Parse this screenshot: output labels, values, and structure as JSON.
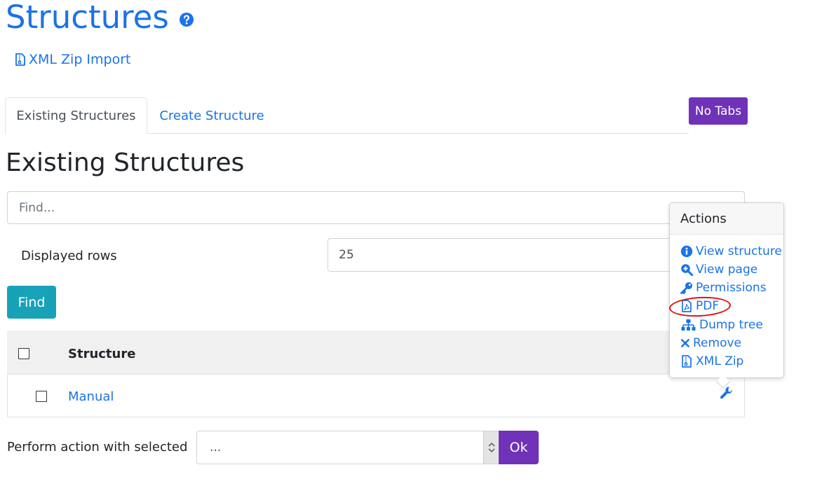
{
  "header": {
    "title": "Structures",
    "help_icon": "question-circle-icon"
  },
  "import": {
    "label": "XML Zip Import",
    "icon": "file-archive-icon"
  },
  "tabs": [
    {
      "label": "Existing Structures",
      "active": true
    },
    {
      "label": "Create Structure",
      "active": false
    }
  ],
  "no_tabs_label": "No Tabs",
  "section": {
    "title": "Existing Structures"
  },
  "search": {
    "placeholder": "Find...",
    "value": ""
  },
  "displayed_rows": {
    "label": "Displayed rows",
    "value": "25"
  },
  "find_button": "Find",
  "table": {
    "columns": [
      "Structure"
    ],
    "rows": [
      {
        "name": "Manual"
      }
    ]
  },
  "bulk": {
    "label": "Perform action with selected",
    "selected": "...",
    "ok_label": "Ok"
  },
  "popover": {
    "title": "Actions",
    "items": [
      {
        "label": "View structure",
        "icon": "info-circle-icon"
      },
      {
        "label": "View page",
        "icon": "search-plus-icon"
      },
      {
        "label": "Permissions",
        "icon": "key-icon"
      },
      {
        "label": "PDF",
        "icon": "file-pdf-icon"
      },
      {
        "label": "Dump tree",
        "icon": "sitemap-icon"
      },
      {
        "label": "Remove",
        "icon": "times-icon"
      },
      {
        "label": "XML Zip",
        "icon": "file-archive-icon"
      }
    ]
  },
  "colors": {
    "link": "#1a73e8",
    "purple": "#6f32b8",
    "teal": "#17a2b8",
    "annotation": "#e01010"
  }
}
